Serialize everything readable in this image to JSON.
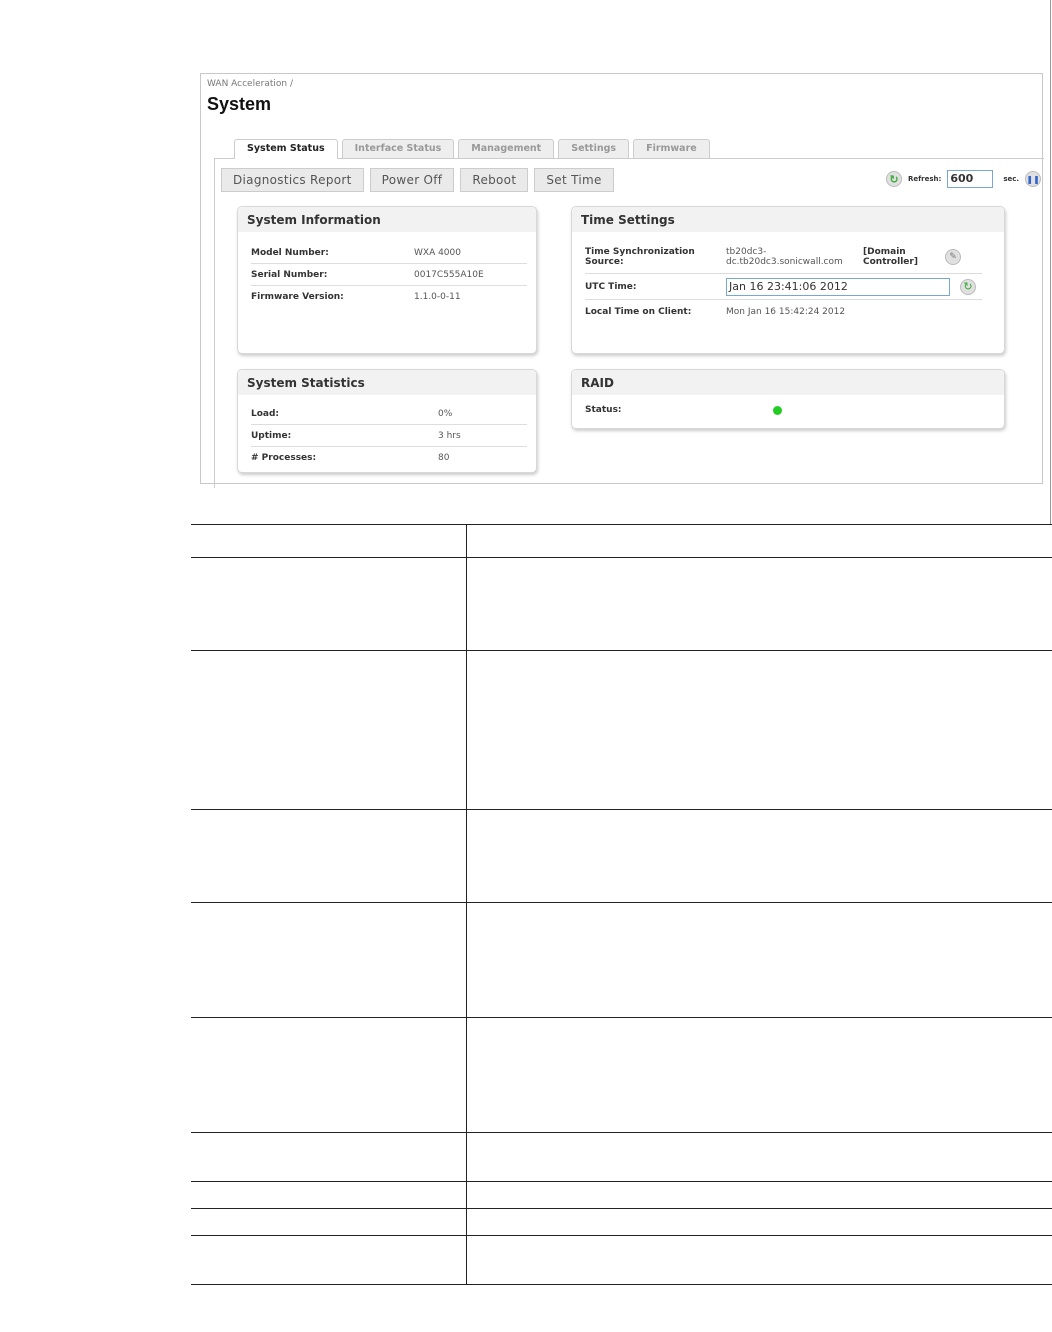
{
  "breadcrumb": "WAN Acceleration /",
  "page_title": "System",
  "tabs": [
    {
      "label": "System Status",
      "active": true
    },
    {
      "label": "Interface Status"
    },
    {
      "label": "Management"
    },
    {
      "label": "Settings"
    },
    {
      "label": "Firmware"
    }
  ],
  "toolbar": {
    "diagnostics": "Diagnostics Report",
    "power_off": "Power Off",
    "reboot": "Reboot",
    "set_time": "Set Time",
    "refresh_label": "Refresh:",
    "refresh_value": "600",
    "refresh_unit": "sec."
  },
  "system_information": {
    "title": "System Information",
    "rows": [
      {
        "label": "Model Number:",
        "value": "WXA 4000"
      },
      {
        "label": "Serial Number:",
        "value": "0017C555A10E"
      },
      {
        "label": "Firmware Version:",
        "value": "1.1.0-0-11"
      }
    ]
  },
  "time_settings": {
    "title": "Time Settings",
    "sync_label": "Time Synchronization Source:",
    "sync_value": "tb20dc3-dc.tb20dc3.sonicwall.com",
    "sync_type": "[Domain Controller]",
    "utc_label": "UTC Time:",
    "utc_value": "Jan 16 23:41:06 2012",
    "local_label": "Local Time on Client:",
    "local_value": "Mon Jan 16 15:42:24 2012"
  },
  "system_statistics": {
    "title": "System Statistics",
    "rows": [
      {
        "label": "Load:",
        "value": "0%"
      },
      {
        "label": "Uptime:",
        "value": "3 hrs"
      },
      {
        "label": "# Processes:",
        "value": "80"
      }
    ]
  },
  "raid": {
    "title": "RAID",
    "status_label": "Status:",
    "status_color": "#22cc22"
  }
}
